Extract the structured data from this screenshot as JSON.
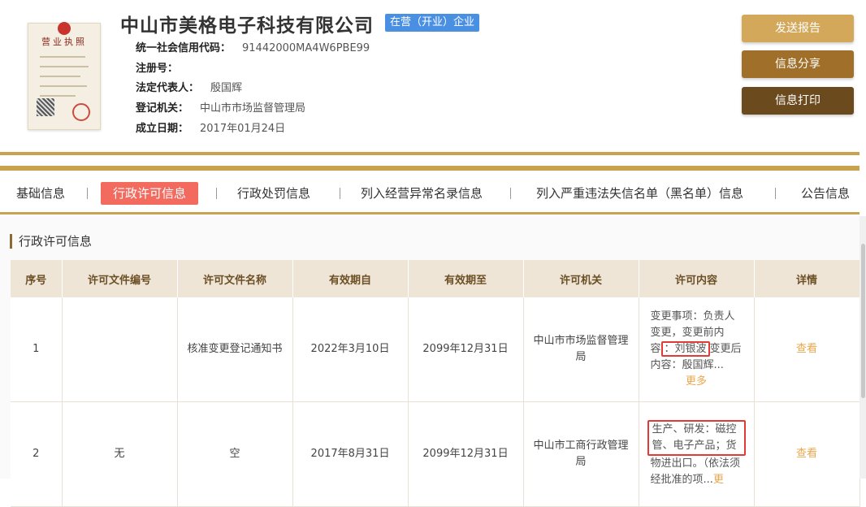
{
  "header": {
    "license_title": "营业执照",
    "company_name": "中山市美格电子科技有限公司",
    "status": "在营（开业）企业",
    "fields": [
      {
        "label": "统一社会信用代码：",
        "value": "91442000MA4W6PBE99"
      },
      {
        "label": "注册号：",
        "value": ""
      },
      {
        "label": "法定代表人：",
        "value": "殷国辉"
      },
      {
        "label": "登记机关：",
        "value": "中山市市场监督管理局"
      },
      {
        "label": "成立日期：",
        "value": "2017年01月24日"
      }
    ],
    "buttons": {
      "send_report": "发送报告",
      "share_info": "信息分享",
      "print_info": "信息打印"
    },
    "button_colors": {
      "send_report": "#d4a85a",
      "share_info": "#a0702a",
      "print_info": "#6b4a1e"
    }
  },
  "tabs": [
    {
      "label": "基础信息"
    },
    {
      "label": "行政许可信息",
      "active": true
    },
    {
      "label": "行政处罚信息"
    },
    {
      "label": "列入经营异常名录信息"
    },
    {
      "label": "列入严重违法失信名单（黑名单）信息"
    },
    {
      "label": "公告信息"
    }
  ],
  "section": {
    "title": "行政许可信息",
    "columns": [
      "序号",
      "许可文件编号",
      "许可文件名称",
      "有效期自",
      "有效期至",
      "许可机关",
      "许可内容",
      "详情"
    ],
    "rows": [
      {
        "index": "1",
        "doc_no": "",
        "doc_name": "核准变更登记通知书",
        "valid_from": "2022年3月10日",
        "valid_to": "2099年12月31日",
        "authority": "中山市市场监督管理局",
        "content_a": "变更事项：负责人变更，变更前内容",
        "content_hl": "：刘银波",
        "content_b": "变更后内容：殷国辉...",
        "more": "更多",
        "detail": "查看"
      },
      {
        "index": "2",
        "doc_no": "无",
        "doc_name": "空",
        "valid_from": "2017年8月31日",
        "valid_to": "2099年12月31日",
        "authority": "中山市工商行政管理局",
        "content_hl": "生产、研发：磁控管、电子产品；货",
        "content_b": "物进出口。（依法须经批准的项...",
        "more": "更",
        "detail": "查看"
      }
    ]
  },
  "colors": {
    "accent_gold": "#c9a24f",
    "active_tab": "#f36b5f",
    "link": "#e8a74c",
    "highlight_border": "#e23b36"
  }
}
